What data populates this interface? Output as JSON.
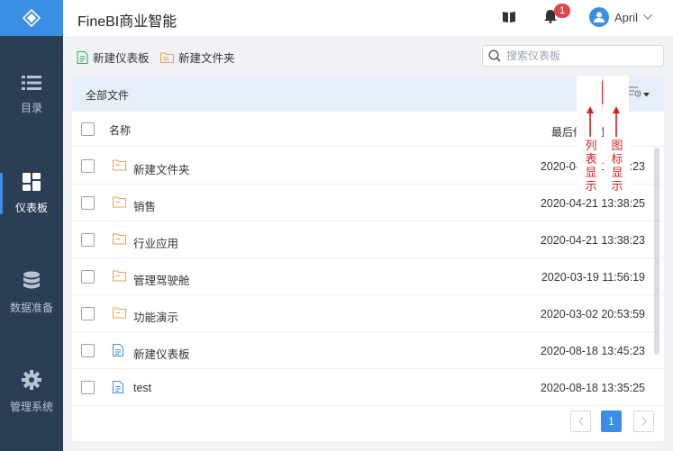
{
  "app": {
    "title": "FineBI商业智能"
  },
  "sidebar": {
    "items": [
      {
        "label": "目录",
        "icon": "list-icon"
      },
      {
        "label": "仪表板",
        "icon": "dashboard-icon",
        "active": true
      },
      {
        "label": "数据准备",
        "icon": "database-icon"
      },
      {
        "label": "管理系统",
        "icon": "gear-icon"
      }
    ]
  },
  "header": {
    "notification_count": "1",
    "user_name": "April"
  },
  "toolbar": {
    "new_dashboard": "新建仪表板",
    "new_folder": "新建文件夹",
    "search_placeholder": "搜索仪表板"
  },
  "panel": {
    "title": "全部文件",
    "col_name": "名称",
    "col_time": "最后修改时间",
    "rows": [
      {
        "name": "新建文件夹",
        "time": "2020-04-21 13:38:23",
        "type": "folder"
      },
      {
        "name": "销售",
        "time": "2020-04-21 13:38:25",
        "type": "folder"
      },
      {
        "name": "行业应用",
        "time": "2020-04-21 13:38:23",
        "type": "folder"
      },
      {
        "name": "管理驾驶舱",
        "time": "2020-03-19 11:56:19",
        "type": "folder"
      },
      {
        "name": "功能演示",
        "time": "2020-03-02 20:53:59",
        "type": "folder"
      },
      {
        "name": "新建仪表板",
        "time": "2020-08-18 13:45:23",
        "type": "dashboard"
      },
      {
        "name": "test",
        "time": "2020-08-18 13:35:25",
        "type": "dashboard"
      }
    ]
  },
  "annotations": {
    "list_view": "列表显示",
    "icon_view": "图标显示"
  },
  "pagination": {
    "current": "1"
  },
  "colors": {
    "accent": "#3a8ee6",
    "sidebar": "#2c3e55",
    "annotation": "#d62020",
    "folder": "#f0a04b"
  }
}
